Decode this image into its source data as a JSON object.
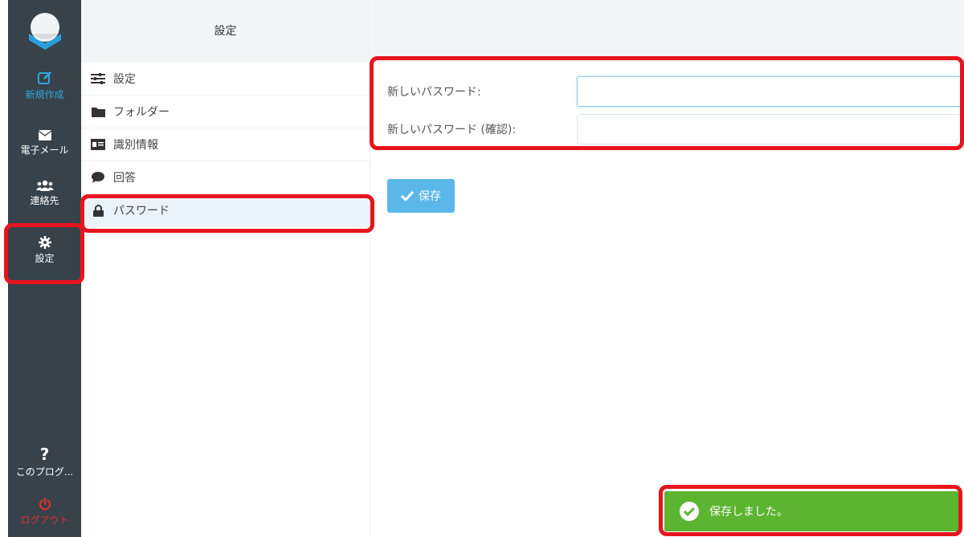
{
  "nav": {
    "items": [
      {
        "label": "新規作成",
        "icon": "compose-icon"
      },
      {
        "label": "電子メール",
        "icon": "mail-icon"
      },
      {
        "label": "連絡先",
        "icon": "contacts-icon"
      },
      {
        "label": "設定",
        "icon": "gear-icon"
      }
    ],
    "about": {
      "label": "このプログ...",
      "icon": "question-icon"
    },
    "logout": {
      "label": "ログアウト",
      "icon": "power-icon"
    }
  },
  "settings_list": {
    "header": "設定",
    "items": [
      {
        "label": "設定",
        "icon": "sliders-icon"
      },
      {
        "label": "フォルダー",
        "icon": "folder-icon"
      },
      {
        "label": "識別情報",
        "icon": "id-card-icon"
      },
      {
        "label": "回答",
        "icon": "comment-icon"
      },
      {
        "label": "パスワード",
        "icon": "lock-icon"
      }
    ],
    "active": "パスワード"
  },
  "password_form": {
    "new_password_label": "新しいパスワード:",
    "new_password_value": "",
    "confirm_password_label": "新しいパスワード (確認):",
    "confirm_password_value": "",
    "save_label": "保存"
  },
  "toast": {
    "message": "保存しました。",
    "icon": "check-circle-icon"
  },
  "colors": {
    "nav_bg": "#37424a",
    "accent": "#5bb7ea",
    "toast_bg": "#5cb431",
    "highlight": "#e8141d",
    "logout": "#e03030"
  }
}
